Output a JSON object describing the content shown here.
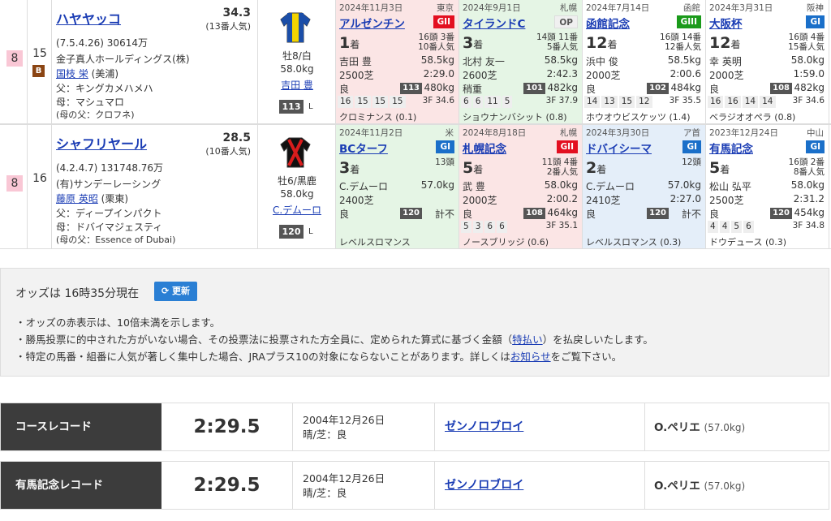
{
  "horses": [
    {
      "waku": "8",
      "umaban": "15",
      "blinker": "B",
      "name": "ハヤヤッコ",
      "odds": "34.3",
      "popularity": "(13番人気)",
      "birth_prize": "(7.5.4.26)  30614万",
      "owner": "金子真人ホールディングス(株)",
      "trainer": "国枝 栄",
      "trainer_loc": "(美浦)",
      "sire": "父：キングカメハメハ",
      "dam": "母：マシュマロ",
      "damsire": "(母の父：クロフネ)",
      "sex_age": "牡8/白",
      "weight": "58.0kg",
      "jockey": "吉田 豊",
      "rating": "113",
      "rating_unit": "L",
      "silk_colors": {
        "body": "#f3d400",
        "accent": "#1b4ea8"
      },
      "races": [
        {
          "date": "2024年11月3日",
          "place": "東京",
          "name": "アルゼンチン",
          "grade": "GII",
          "grade_class": "g2",
          "pos": "1",
          "pos_unit": "着",
          "field": "16頭 3番\n10番人気",
          "jockey": "吉田 豊",
          "weight": "58.5kg",
          "dist": "2500芝",
          "time": "2:29.0",
          "cond": "良",
          "rating": "113",
          "body_weight": "480kg",
          "corners": [
            "16",
            "15",
            "15",
            "15"
          ],
          "l3f": "3F 34.6",
          "winner": "クロミナンス (0.1)"
        },
        {
          "date": "2024年9月1日",
          "place": "札幌",
          "name": "タイランドC",
          "grade": "OP",
          "grade_class": "op",
          "pos": "3",
          "pos_unit": "着",
          "field": "14頭 11番\n5番人気",
          "jockey": "北村 友一",
          "weight": "58.5kg",
          "dist": "2600芝",
          "time": "2:42.3",
          "cond": "稍重",
          "rating": "101",
          "body_weight": "482kg",
          "corners": [
            "6",
            "6",
            "11",
            "5"
          ],
          "l3f": "3F 37.9",
          "winner": "ショウナンバシット (0.8)"
        },
        {
          "date": "2024年7月14日",
          "place": "函館",
          "name": "函館記念",
          "grade": "GIII",
          "grade_class": "g3",
          "pos": "12",
          "pos_unit": "着",
          "field": "16頭 14番\n12番人気",
          "jockey": "浜中 俊",
          "weight": "58.5kg",
          "dist": "2000芝",
          "time": "2:00.6",
          "cond": "良",
          "rating": "102",
          "body_weight": "484kg",
          "corners": [
            "14",
            "13",
            "15",
            "12"
          ],
          "l3f": "3F 35.5",
          "winner": "ホウオウビスケッツ (1.4)"
        },
        {
          "date": "2024年3月31日",
          "place": "阪神",
          "name": "大阪杯",
          "grade": "GI",
          "grade_class": "g1",
          "pos": "12",
          "pos_unit": "着",
          "field": "16頭 4番\n15番人気",
          "jockey": "幸 英明",
          "weight": "58.0kg",
          "dist": "2000芝",
          "time": "1:59.0",
          "cond": "良",
          "rating": "108",
          "body_weight": "482kg",
          "corners": [
            "16",
            "16",
            "14",
            "14"
          ],
          "l3f": "3F 34.6",
          "winner": "ベラジオオペラ (0.8)"
        }
      ]
    },
    {
      "waku": "8",
      "umaban": "16",
      "blinker": "",
      "name": "シャフリヤール",
      "odds": "28.5",
      "popularity": "(10番人気)",
      "birth_prize": "(4.2.4.7)  131748.76万",
      "owner": "(有)サンデーレーシング",
      "trainer": "藤原 英昭",
      "trainer_loc": "(栗東)",
      "sire": "父：ディープインパクト",
      "dam": "母：ドバイマジェスティ",
      "damsire": "(母の父：Essence of Dubai)",
      "sex_age": "牡6/黒鹿",
      "weight": "58.0kg",
      "jockey": "C.デムーロ",
      "rating": "120",
      "rating_unit": "L",
      "silk_colors": {
        "body": "#111111",
        "accent": "#d81c1c"
      },
      "races": [
        {
          "date": "2024年11月2日",
          "place": "米",
          "name": "BCターフ",
          "grade": "GI",
          "grade_class": "g1",
          "pos": "3",
          "pos_unit": "着",
          "field": "13頭",
          "jockey": "C.デムーロ",
          "weight": "57.0kg",
          "dist": "2400芝",
          "time": "",
          "cond": "良",
          "rating": "120",
          "body_weight": "計不",
          "corners": [],
          "l3f": "",
          "winner": "レベルスロマンス"
        },
        {
          "date": "2024年8月18日",
          "place": "札幌",
          "name": "札幌記念",
          "grade": "GII",
          "grade_class": "g2",
          "pos": "5",
          "pos_unit": "着",
          "field": "11頭 4番\n2番人気",
          "jockey": "武 豊",
          "weight": "58.0kg",
          "dist": "2000芝",
          "time": "2:00.2",
          "cond": "良",
          "rating": "108",
          "body_weight": "464kg",
          "corners": [
            "5",
            "3",
            "6",
            "6"
          ],
          "l3f": "3F 35.1",
          "winner": "ノースブリッジ (0.6)"
        },
        {
          "date": "2024年3月30日",
          "place": "ア首",
          "name": "ドバイシーマ",
          "grade": "GI",
          "grade_class": "g1",
          "pos": "2",
          "pos_unit": "着",
          "field": "12頭",
          "jockey": "C.デムーロ",
          "weight": "57.0kg",
          "dist": "2410芝",
          "time": "2:27.0",
          "cond": "良",
          "rating": "120",
          "body_weight": "計不",
          "corners": [],
          "l3f": "",
          "winner": "レベルスロマンス (0.3)"
        },
        {
          "date": "2023年12月24日",
          "place": "中山",
          "name": "有馬記念",
          "grade": "GI",
          "grade_class": "g1",
          "pos": "5",
          "pos_unit": "着",
          "field": "16頭 2番\n8番人気",
          "jockey": "松山 弘平",
          "weight": "58.0kg",
          "dist": "2500芝",
          "time": "2:31.2",
          "cond": "良",
          "rating": "120",
          "body_weight": "454kg",
          "corners": [
            "4",
            "4",
            "5",
            "6"
          ],
          "l3f": "3F 34.8",
          "winner": "ドウデュース (0.3)"
        }
      ]
    }
  ],
  "odds_panel": {
    "time_text": "オッズは 16時35分現在",
    "refresh_label": "更新",
    "note1": "・オッズの赤表示は、10倍未満を示します。",
    "note2_pre": "・勝馬投票に的中された方がいない場合、その投票法に投票された方全員に、定められた算式に基づく金額（",
    "note2_link": "特払い",
    "note2_post": "）を払戻しいたします。",
    "note3_pre": "・特定の馬番・組番に人気が著しく集中した場合、JRAプラス10の対象にならないことがあります。詳しくは",
    "note3_link": "お知らせ",
    "note3_post": "をご覧下さい。"
  },
  "records": [
    {
      "label": "コースレコード",
      "time": "2:29.5",
      "date": "2004年12月26日",
      "weather": "晴/芝：良",
      "horse": "ゼンノロブロイ",
      "jockey": "O.ペリエ",
      "weight": "(57.0kg)"
    },
    {
      "label": "有馬記念レコード",
      "time": "2:29.5",
      "date": "2004年12月26日",
      "weather": "晴/芝：良",
      "horse": "ゼンノロブロイ",
      "jockey": "O.ペリエ",
      "weight": "(57.0kg)"
    }
  ]
}
